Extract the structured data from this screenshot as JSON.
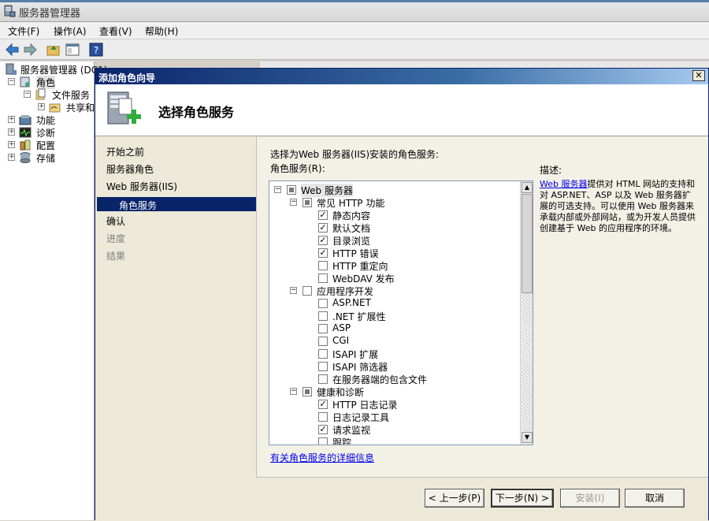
{
  "window": {
    "title": "服务器管理器"
  },
  "menu": {
    "items": [
      "文件(F)",
      "操作(A)",
      "查看(V)",
      "帮助(H)"
    ]
  },
  "tree": {
    "root": "服务器管理器 (DC1)",
    "roles": "角色",
    "file_services": "文件服务",
    "share": "共享和",
    "features": "功能",
    "diagnostics": "诊断",
    "configuration": "配置",
    "storage": "存储"
  },
  "dialog": {
    "title": "添加角色向导",
    "close_glyph": "✕",
    "header_title": "选择角色服务",
    "nav": {
      "before_you_begin": "开始之前",
      "server_roles": "服务器角色",
      "web_server": "Web 服务器(IIS)",
      "role_services": "角色服务",
      "confirmation": "确认",
      "progress": "进度",
      "results": "结果"
    },
    "instruction": "选择为Web 服务器(IIS)安装的角色服务:",
    "list_label": "角色服务(R):",
    "role_services": [
      {
        "label": "Web 服务器",
        "level": 0,
        "state": "partial",
        "expander": "⊟"
      },
      {
        "label": "常见 HTTP 功能",
        "level": 1,
        "state": "partial",
        "expander": "⊟"
      },
      {
        "label": "静态内容",
        "level": 2,
        "state": "checked"
      },
      {
        "label": "默认文档",
        "level": 2,
        "state": "checked"
      },
      {
        "label": "目录浏览",
        "level": 2,
        "state": "checked"
      },
      {
        "label": "HTTP 错误",
        "level": 2,
        "state": "checked"
      },
      {
        "label": "HTTP 重定向",
        "level": 2,
        "state": "unchecked"
      },
      {
        "label": "WebDAV 发布",
        "level": 2,
        "state": "unchecked"
      },
      {
        "label": "应用程序开发",
        "level": 1,
        "state": "unchecked",
        "expander": "⊟"
      },
      {
        "label": "ASP.NET",
        "level": 2,
        "state": "unchecked"
      },
      {
        "label": ".NET 扩展性",
        "level": 2,
        "state": "unchecked"
      },
      {
        "label": "ASP",
        "level": 2,
        "state": "unchecked"
      },
      {
        "label": "CGI",
        "level": 2,
        "state": "unchecked"
      },
      {
        "label": "ISAPI 扩展",
        "level": 2,
        "state": "unchecked"
      },
      {
        "label": "ISAPI 筛选器",
        "level": 2,
        "state": "unchecked"
      },
      {
        "label": "在服务器端的包含文件",
        "level": 2,
        "state": "unchecked"
      },
      {
        "label": "健康和诊断",
        "level": 1,
        "state": "partial",
        "expander": "⊟"
      },
      {
        "label": "HTTP 日志记录",
        "level": 2,
        "state": "checked"
      },
      {
        "label": "日志记录工具",
        "level": 2,
        "state": "unchecked"
      },
      {
        "label": "请求监视",
        "level": 2,
        "state": "checked"
      },
      {
        "label": "跟踪",
        "level": 2,
        "state": "unchecked"
      }
    ],
    "more_info_link": "有关角色服务的详细信息",
    "description": {
      "title": "描述:",
      "link": "Web 服务器",
      "text": "提供对 HTML 网站的支持和对 ASP.NET、ASP 以及 Web 服务器扩展的可选支持。可以使用 Web 服务器来承载内部或外部网站，或为开发人员提供创建基于 Web 的应用程序的环境。"
    },
    "buttons": {
      "back": "< 上一步(P)",
      "next": "下一步(N) >",
      "install": "安装(I)",
      "cancel": "取消"
    }
  }
}
